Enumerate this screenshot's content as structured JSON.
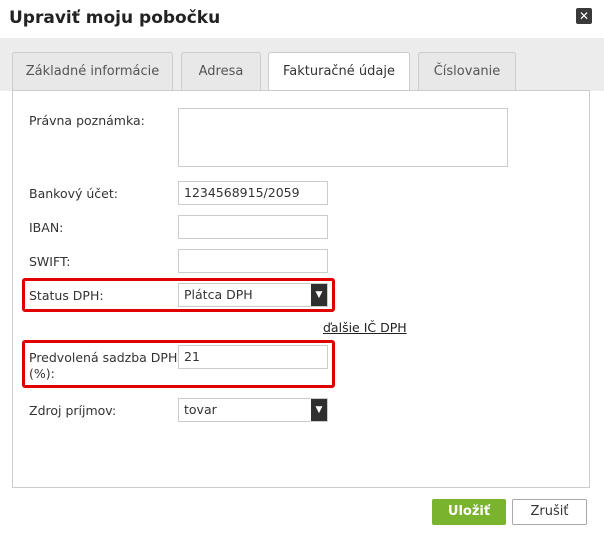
{
  "dialog": {
    "title": "Upraviť moju pobočku",
    "close_label": "✕"
  },
  "tabs": [
    {
      "label": "Základné informácie",
      "active": false
    },
    {
      "label": "Adresa",
      "active": false
    },
    {
      "label": "Fakturačné údaje",
      "active": true
    },
    {
      "label": "Číslovanie",
      "active": false
    }
  ],
  "form": {
    "legal_note": {
      "label": "Právna poznámka:",
      "value": ""
    },
    "bank_account": {
      "label": "Bankový účet:",
      "value": "1234568915/2059"
    },
    "iban": {
      "label": "IBAN:",
      "value": ""
    },
    "swift": {
      "label": "SWIFT:",
      "value": ""
    },
    "vat_status": {
      "label": "Status DPH:",
      "value": "Plátca DPH"
    },
    "more_vat_link": "ďalšie IČ DPH",
    "default_vat_rate": {
      "label": "Predvolená sadzba DPH (%):",
      "value": "21"
    },
    "income_source": {
      "label": "Zdroj príjmov:",
      "value": "tovar"
    }
  },
  "buttons": {
    "save": "Uložiť",
    "cancel": "Zrušiť"
  },
  "colors": {
    "accent_save": "#7ab32e",
    "highlight": "#e00000"
  }
}
